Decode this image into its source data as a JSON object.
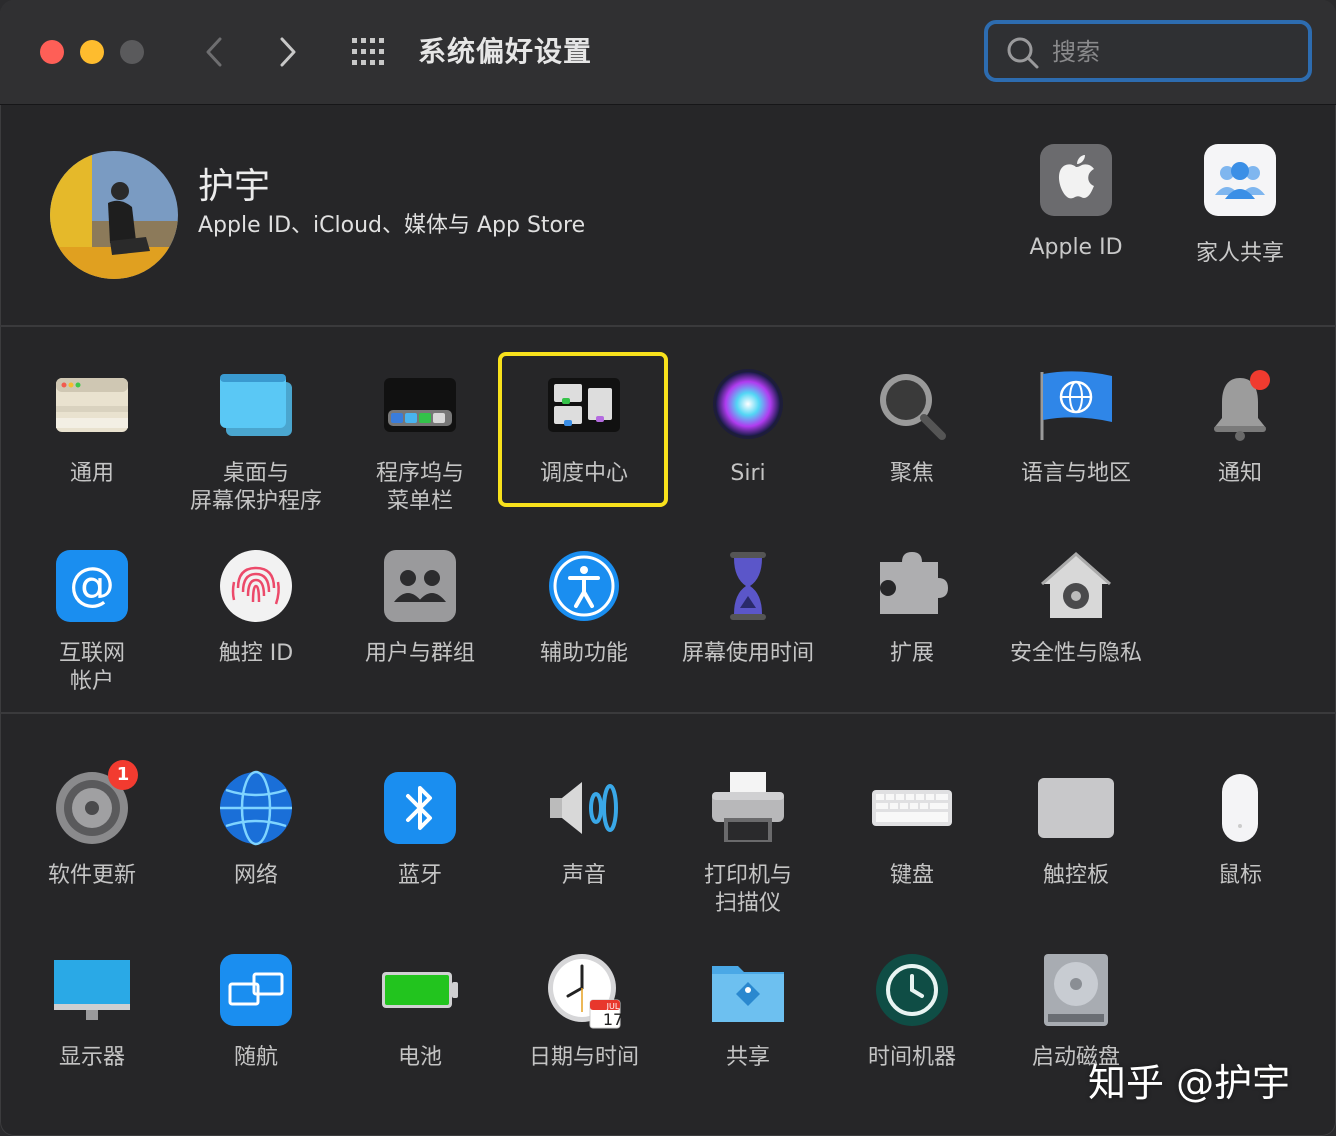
{
  "window": {
    "title": "系统偏好设置",
    "search": {
      "placeholder": "搜索",
      "value": ""
    }
  },
  "account": {
    "name": "护宇",
    "subtitle": "Apple ID、iCloud、媒体与 App Store",
    "items": [
      {
        "label": "Apple ID",
        "icon": "apple-logo-icon"
      },
      {
        "label": "家人共享",
        "icon": "family-sharing-icon"
      }
    ]
  },
  "section1": [
    {
      "label": "通用",
      "icon": "general-icon"
    },
    {
      "label": "桌面与\n屏幕保护程序",
      "icon": "desktop-screensaver-icon"
    },
    {
      "label": "程序坞与\n菜单栏",
      "icon": "dock-menubar-icon"
    },
    {
      "label": "调度中心",
      "icon": "mission-control-icon",
      "highlighted": true
    },
    {
      "label": "Siri",
      "icon": "siri-icon"
    },
    {
      "label": "聚焦",
      "icon": "spotlight-icon"
    },
    {
      "label": "语言与地区",
      "icon": "language-region-icon"
    },
    {
      "label": "通知",
      "icon": "notifications-icon"
    },
    {
      "label": "互联网\n帐户",
      "icon": "internet-accounts-icon"
    },
    {
      "label": "触控 ID",
      "icon": "touch-id-icon"
    },
    {
      "label": "用户与群组",
      "icon": "users-groups-icon"
    },
    {
      "label": "辅助功能",
      "icon": "accessibility-icon"
    },
    {
      "label": "屏幕使用时间",
      "icon": "screen-time-icon"
    },
    {
      "label": "扩展",
      "icon": "extensions-icon"
    },
    {
      "label": "安全性与隐私",
      "icon": "security-privacy-icon"
    }
  ],
  "section2": [
    {
      "label": "软件更新",
      "icon": "software-update-icon",
      "badge": "1"
    },
    {
      "label": "网络",
      "icon": "network-icon"
    },
    {
      "label": "蓝牙",
      "icon": "bluetooth-icon"
    },
    {
      "label": "声音",
      "icon": "sound-icon"
    },
    {
      "label": "打印机与\n扫描仪",
      "icon": "printers-scanners-icon"
    },
    {
      "label": "键盘",
      "icon": "keyboard-icon"
    },
    {
      "label": "触控板",
      "icon": "trackpad-icon"
    },
    {
      "label": "鼠标",
      "icon": "mouse-icon"
    },
    {
      "label": "显示器",
      "icon": "displays-icon"
    },
    {
      "label": "随航",
      "icon": "sidecar-icon"
    },
    {
      "label": "电池",
      "icon": "battery-icon"
    },
    {
      "label": "日期与时间",
      "icon": "date-time-icon",
      "calendar_month": "JUL",
      "calendar_day": "17"
    },
    {
      "label": "共享",
      "icon": "sharing-icon"
    },
    {
      "label": "时间机器",
      "icon": "time-machine-icon"
    },
    {
      "label": "启动磁盘",
      "icon": "startup-disk-icon"
    }
  ],
  "watermark": "知乎 @护宇",
  "colors": {
    "window_bg": "#262628",
    "titlebar_bg": "#303032",
    "highlight": "#f8e11c",
    "search_focus": "#2d6cb0",
    "badge": "#f23b30"
  }
}
